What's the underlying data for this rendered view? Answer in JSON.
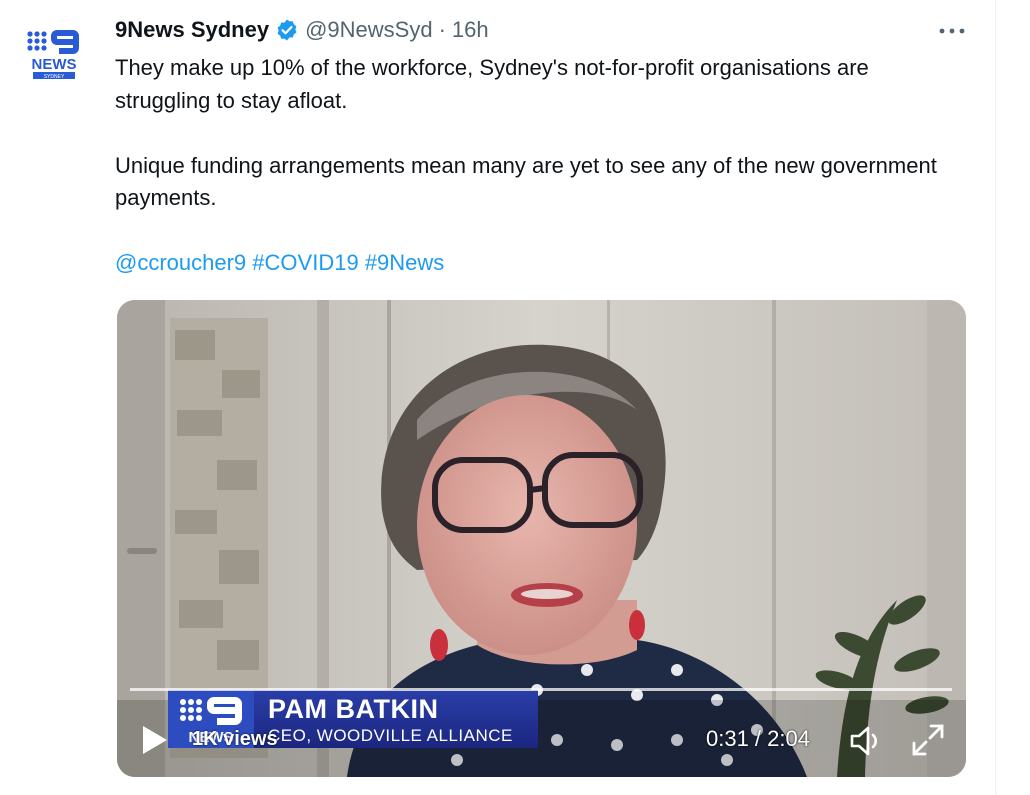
{
  "tweet": {
    "author_name": "9News Sydney",
    "handle": "@9NewsSyd",
    "separator": "·",
    "time": "16h",
    "avatar_logo": {
      "line1": "NEWS",
      "line2": "SYDNEY"
    },
    "more_label": "•••",
    "paragraph1": "They make up 10% of the workforce, Sydney's not-for-profit organisations are struggling to stay afloat.",
    "paragraph2": "Unique funding arrangements mean many are yet to see any of the new government payments.",
    "mentions": [
      "@ccroucher9",
      "#COVID19",
      "#9News"
    ]
  },
  "video": {
    "lower_third_name": "PAM BATKIN",
    "lower_third_title": "CEO, WOODVILLE ALLIANCE",
    "lower_third_logo": "NEWS",
    "views": "1K views",
    "timecode": "0:31 / 2:04",
    "progress_fraction": 0.25
  },
  "icons": [
    "verified-badge-icon",
    "more-icon",
    "play-icon",
    "volume-icon",
    "fullscreen-icon"
  ],
  "colors": {
    "link": "#1d9bf0",
    "verified": "#1d9bf0",
    "lower_third": "#22339a"
  }
}
